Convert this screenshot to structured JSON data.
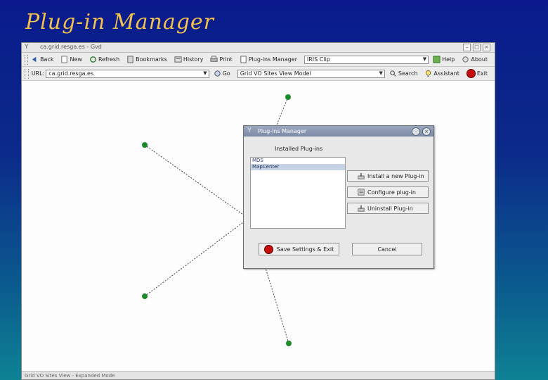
{
  "slide": {
    "title": "Plug-in Manager"
  },
  "window": {
    "title": "ca.grid.resga.es - Gvd",
    "status": "Grid VO Sites View - Expanded Mode"
  },
  "toolbar1": {
    "back": "Back",
    "new": "New",
    "refresh": "Refresh",
    "bookmarks": "Bookmarks",
    "history": "History",
    "print": "Print",
    "plugins_manager": "Plug-ins Manager",
    "plugin_combo": "IRIS Clip",
    "help": "Help",
    "about": "About"
  },
  "toolbar2": {
    "url_label": "URL:",
    "url_value": "ca.grid.resga.es",
    "go": "Go",
    "model_combo": "Grid VO Sites View Model",
    "search": "Search",
    "assistant": "Assistant",
    "exit": "Exit"
  },
  "dialog": {
    "title": "Plug-ins Manager",
    "installed_label": "Installed Plug-ins",
    "plugins": [
      "MDS",
      "MapCenter"
    ],
    "selected_index": 1,
    "install_btn": "Install a new Plug-in",
    "configure_btn": "Configure plug-in",
    "uninstall_btn": "Uninstall Plug-in",
    "save_btn": "Save Settings & Exit",
    "cancel_btn": "Cancel"
  },
  "colors": {
    "slide_title": "#f2c14e",
    "node": "#1a8a2a",
    "stop": "#c40d0d"
  }
}
